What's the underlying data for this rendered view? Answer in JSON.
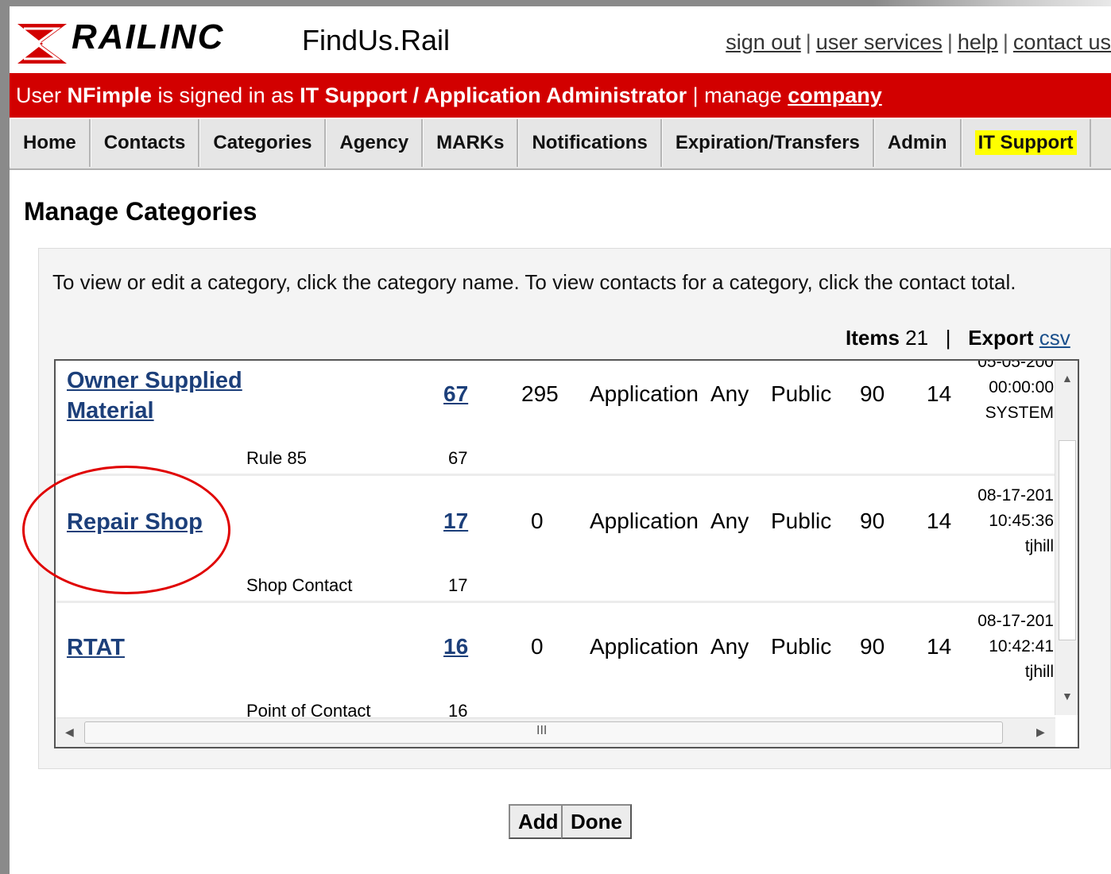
{
  "header": {
    "brand": "RAILINC",
    "app_title": "FindUs.Rail",
    "links": [
      "sign out",
      "user services",
      "help",
      "contact us"
    ],
    "link_separator": "|"
  },
  "userbar": {
    "prefix": "User ",
    "username": "NFimple",
    "mid": " is signed in as ",
    "role": "IT Support / Application Administrator",
    "sep": " | manage ",
    "manage_link": "company"
  },
  "nav": {
    "items": [
      "Home",
      "Contacts",
      "Categories",
      "Agency",
      "MARKs",
      "Notifications",
      "Expiration/Transfers",
      "Admin",
      "IT Support"
    ],
    "active": "IT Support"
  },
  "page_title": "Manage Categories",
  "instructions": "To view or edit a category, click the category name. To view contacts for a category, click the contact total.",
  "items_bar": {
    "items_label": "Items",
    "items_count": "21",
    "sep": "|",
    "export_label": "Export",
    "export_link": "csv"
  },
  "rows": [
    {
      "name_line1": "Owner Supplied",
      "name_line2": "Material",
      "contacts": "67",
      "count": "295",
      "type": "Application",
      "scope": "Any",
      "visibility": "Public",
      "days": "90",
      "notice": "14",
      "ts_date": "05-05-200",
      "ts_time": "00:00:00",
      "ts_user": "SYSTEM",
      "sub_name": "Rule 85",
      "sub_count": "67"
    },
    {
      "name_line1": "Repair Shop",
      "name_line2": "",
      "contacts": "17",
      "count": "0",
      "type": "Application",
      "scope": "Any",
      "visibility": "Public",
      "days": "90",
      "notice": "14",
      "ts_date": "08-17-201",
      "ts_time": "10:45:36",
      "ts_user": "tjhill",
      "sub_name": "Shop Contact",
      "sub_count": "17"
    },
    {
      "name_line1": "RTAT",
      "name_line2": "",
      "contacts": "16",
      "count": "0",
      "type": "Application",
      "scope": "Any",
      "visibility": "Public",
      "days": "90",
      "notice": "14",
      "ts_date": "08-17-201",
      "ts_time": "10:42:41",
      "ts_user": "tjhill",
      "sub_name": "Point of Contact",
      "sub_count": "16"
    }
  ],
  "scroll_thumb_label": "III",
  "buttons": {
    "add": "Add",
    "done": "Done"
  },
  "colors": {
    "brand_red": "#d20000",
    "link_blue": "#1c3f7a",
    "active_tab_highlight": "#ffff00",
    "annotation_circle": "#e00000"
  }
}
